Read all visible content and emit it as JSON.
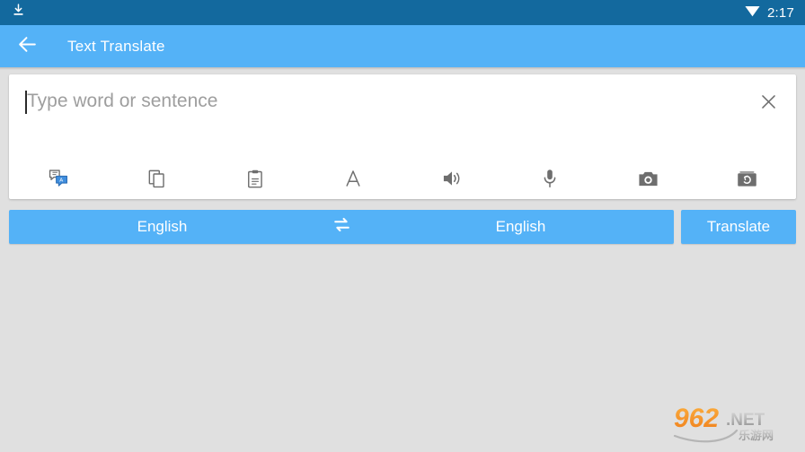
{
  "status_bar": {
    "download_icon": "download-icon",
    "wifi_icon": "wifi-icon",
    "time": "2:17",
    "background": "#13699e"
  },
  "app_bar": {
    "back_icon": "back-arrow-icon",
    "title": "Text Translate",
    "background": "#54b2f7"
  },
  "input_card": {
    "placeholder": "Type word or sentence",
    "value": "",
    "clear_icon": "close-icon",
    "tools": [
      {
        "name": "conversation-translate-icon",
        "label": "Conversation"
      },
      {
        "name": "copy-icon",
        "label": "Copy"
      },
      {
        "name": "paste-icon",
        "label": "Paste"
      },
      {
        "name": "font-size-icon",
        "label": "A"
      },
      {
        "name": "speaker-icon",
        "label": "Speak"
      },
      {
        "name": "microphone-icon",
        "label": "Voice input"
      },
      {
        "name": "camera-icon",
        "label": "Camera"
      },
      {
        "name": "gallery-icon",
        "label": "Gallery"
      }
    ]
  },
  "language_bar": {
    "source_language": "English",
    "swap_icon": "swap-icon",
    "target_language": "English",
    "translate_label": "Translate",
    "accent": "#54b2f7"
  },
  "watermark": {
    "number": "962",
    "suffix": ".NET",
    "cn_text": "乐游网"
  }
}
